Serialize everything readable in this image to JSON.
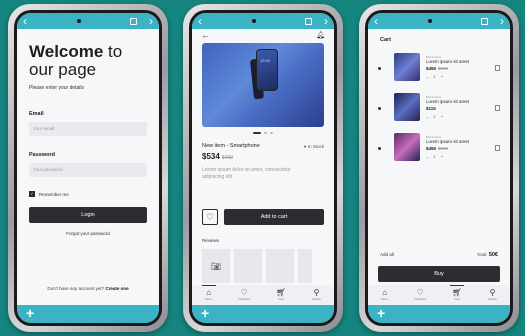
{
  "login": {
    "title_bold": "Welcome",
    "title_rest": " to",
    "title_line2": "our page",
    "subtitle": "Please enter your details",
    "email_label": "Email",
    "email_placeholder": "Your email",
    "password_label": "Password",
    "password_placeholder": "Your password",
    "remember_label": "Remember me",
    "login_button": "Login",
    "forgot_link": "Forgot your password",
    "no_account": "Don't have any account yet?",
    "create_link": "Create one"
  },
  "product": {
    "name": "New item - Smartphone",
    "price": "$534",
    "old_price": "$700",
    "stock": "In Stock",
    "description": "Lorem ipsum dolor sit amet, consectetur adipiscing elit.",
    "add_to_cart": "Add to cart",
    "reviews_label": "Reviews",
    "hero_time": "12:00"
  },
  "cart": {
    "title": "Cart",
    "items": [
      {
        "brand": "Brand name",
        "name": "Lorem ipsum sit amet",
        "price": "$455",
        "old": "$500",
        "qty": "1"
      },
      {
        "brand": "Brand name",
        "name": "Lorem ipsum sit amet",
        "price": "$115",
        "old": "",
        "qty": "2"
      },
      {
        "brand": "Brand name",
        "name": "Lorem ipsum sit amet",
        "price": "$455",
        "old": "$500",
        "qty": "1"
      }
    ],
    "add_all": "Add all",
    "total_label": "Total:",
    "total_value": "50€",
    "buy_button": "Buy"
  },
  "nav": {
    "items": [
      "Home",
      "Favorites",
      "Cart",
      "Search"
    ]
  },
  "colors": {
    "background": "#16857f",
    "accent": "#3cb3c4",
    "dark_button": "#2b2d31"
  }
}
